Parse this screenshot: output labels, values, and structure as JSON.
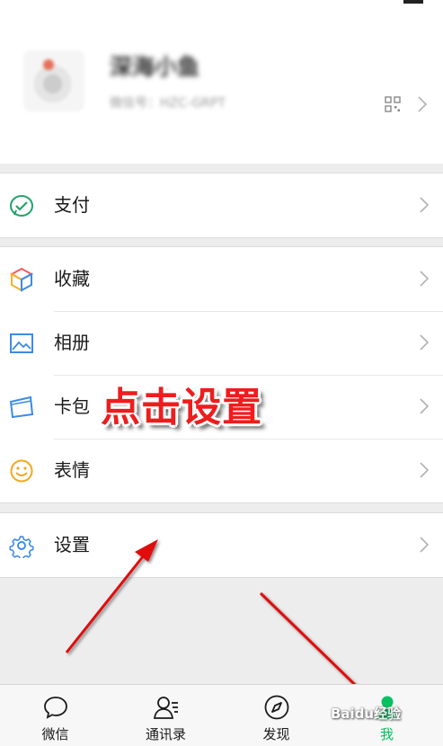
{
  "profile": {
    "nickname": "深海小鱼",
    "wechat_id": "微信号：HZC-GRPT"
  },
  "menu": {
    "pay": "支付",
    "favorites": "收藏",
    "album": "相册",
    "cards": "卡包",
    "stickers": "表情",
    "settings": "设置"
  },
  "annotation": {
    "text": "点击设置"
  },
  "tabbar": {
    "tabs": [
      "微信",
      "通讯录",
      "发现",
      "我"
    ],
    "active_color": "#07c160"
  },
  "watermark": {
    "text": "Baidu经验"
  },
  "colors": {
    "accent_green": "#07c160",
    "annotation_red": "#ee1d1d",
    "arrow_red": "#e01010"
  }
}
